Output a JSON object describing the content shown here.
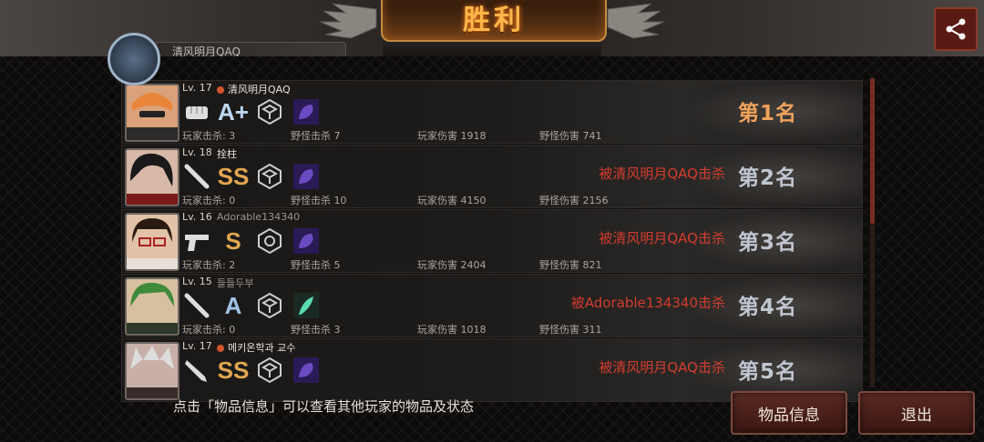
{
  "header": {
    "title": "胜利",
    "player_tag": "清风明月QAQ"
  },
  "players": [
    {
      "level": "Lv. 17",
      "name": "清风明月QAQ",
      "grade": "A+",
      "player_kills": "玩家击杀: 3",
      "monster_kills": "野怪击杀 7",
      "player_damage": "玩家伤害 1918",
      "monster_damage": "野怪伤害 741",
      "killed_by": "",
      "rank": "第1名",
      "weapon_icon": "fist-icon",
      "skill_icon": "hex-cube-icon",
      "gem_icon": "purple-beast-icon"
    },
    {
      "level": "Lv. 18",
      "name": "拴柱",
      "grade": "SS",
      "player_kills": "玩家击杀: 0",
      "monster_kills": "野怪击杀 10",
      "player_damage": "玩家伤害 4150",
      "monster_damage": "野怪伤害 2156",
      "killed_by": "被清风明月QAQ击杀",
      "rank": "第2名",
      "weapon_icon": "bat-icon",
      "skill_icon": "hex-cube-icon",
      "gem_icon": "purple-beast-icon"
    },
    {
      "level": "Lv. 16",
      "name": "Adorable134340",
      "grade": "S",
      "player_kills": "玩家击杀: 2",
      "monster_kills": "野怪击杀 5",
      "player_damage": "玩家伤害 2404",
      "monster_damage": "野怪伤害 821",
      "killed_by": "被清风明月QAQ击杀",
      "rank": "第3名",
      "weapon_icon": "pistol-icon",
      "skill_icon": "hex-gear-icon",
      "gem_icon": "purple-beast-icon"
    },
    {
      "level": "Lv. 15",
      "name": "들들두부",
      "grade": "A",
      "player_kills": "玩家击杀: 0",
      "monster_kills": "野怪击杀 3",
      "player_damage": "玩家伤害 1018",
      "monster_damage": "野怪伤害 311",
      "killed_by": "被Adorable134340击杀",
      "rank": "第4名",
      "weapon_icon": "bat-icon",
      "skill_icon": "hex-cube-icon",
      "gem_icon": "green-feather-icon"
    },
    {
      "level": "Lv. 17",
      "name": "메키온학과 교수",
      "grade": "SS",
      "player_kills": "",
      "monster_kills": "",
      "player_damage": "",
      "monster_damage": "",
      "killed_by": "被清风明月QAQ击杀",
      "rank": "第5名",
      "weapon_icon": "knife-icon",
      "skill_icon": "hex-cube-icon",
      "gem_icon": "purple-beast-icon"
    }
  ],
  "footer": {
    "hint": "点击「物品信息」可以查看其他玩家的物品及状态",
    "items_button": "物品信息",
    "exit_button": "退出"
  },
  "colors": {
    "accent_gold": "#f0a25a",
    "killed_red": "#d43c2e",
    "button_red": "#5a2a22"
  }
}
